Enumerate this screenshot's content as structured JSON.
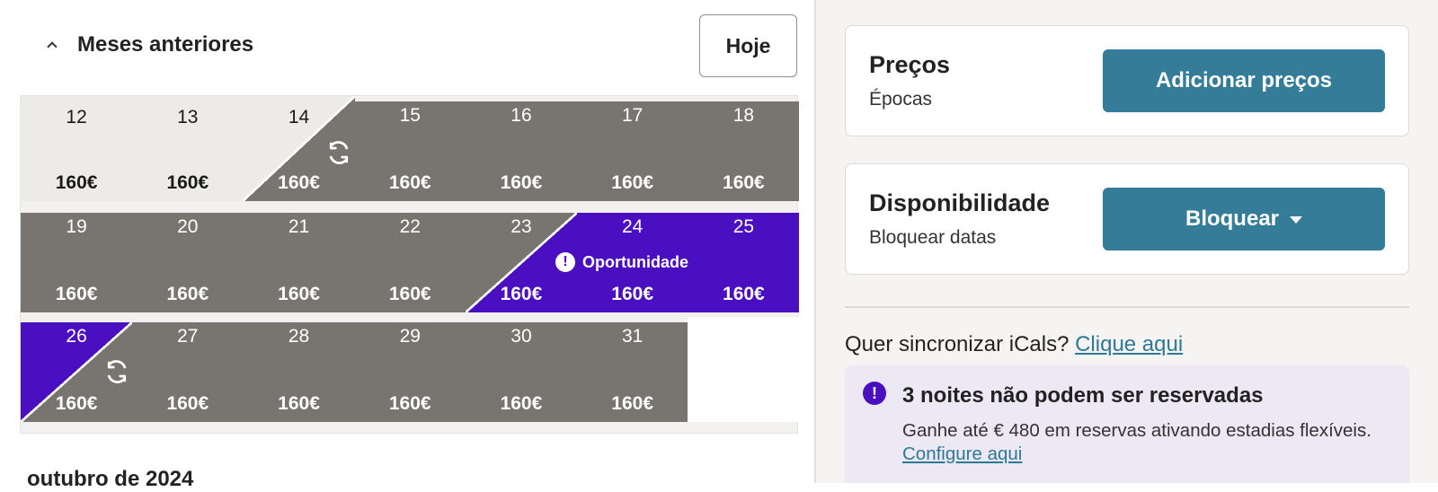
{
  "header": {
    "previous_months_label": "Meses anteriores",
    "today_button": "Hoje"
  },
  "calendar": {
    "weeks": [
      [
        {
          "day": "12",
          "price": "160€",
          "status": "past"
        },
        {
          "day": "13",
          "price": "160€",
          "status": "past"
        },
        {
          "day": "14",
          "price": "160€",
          "status": "past-to-blocked",
          "synced": true
        },
        {
          "day": "15",
          "price": "160€",
          "status": "blocked"
        },
        {
          "day": "16",
          "price": "160€",
          "status": "blocked"
        },
        {
          "day": "17",
          "price": "160€",
          "status": "blocked"
        },
        {
          "day": "18",
          "price": "160€",
          "status": "blocked"
        }
      ],
      [
        {
          "day": "19",
          "price": "160€",
          "status": "blocked"
        },
        {
          "day": "20",
          "price": "160€",
          "status": "blocked"
        },
        {
          "day": "21",
          "price": "160€",
          "status": "blocked"
        },
        {
          "day": "22",
          "price": "160€",
          "status": "blocked"
        },
        {
          "day": "23",
          "price": "160€",
          "status": "blocked-to-opportunity"
        },
        {
          "day": "24",
          "price": "160€",
          "status": "opportunity"
        },
        {
          "day": "25",
          "price": "160€",
          "status": "opportunity"
        }
      ],
      [
        {
          "day": "26",
          "price": "160€",
          "status": "opportunity-to-blocked",
          "synced": true
        },
        {
          "day": "27",
          "price": "160€",
          "status": "blocked"
        },
        {
          "day": "28",
          "price": "160€",
          "status": "blocked"
        },
        {
          "day": "29",
          "price": "160€",
          "status": "blocked"
        },
        {
          "day": "30",
          "price": "160€",
          "status": "blocked"
        },
        {
          "day": "31",
          "price": "160€",
          "status": "blocked"
        }
      ]
    ],
    "opportunity_label": "Oportunidade",
    "next_month_label": "outubro de 2024"
  },
  "prices_card": {
    "title": "Preços",
    "subtitle": "Épocas",
    "button": "Adicionar preços"
  },
  "availability_card": {
    "title": "Disponibilidade",
    "subtitle": "Bloquear datas",
    "button": "Bloquear"
  },
  "ical": {
    "question": "Quer sincronizar iCals?",
    "link": "Clique aqui"
  },
  "alert": {
    "title": "3 noites não podem ser reservadas",
    "body": "Ganhe até € 480 em reservas ativando estadias flexíveis.",
    "link": "Configure aqui"
  },
  "colors": {
    "past": "#ecebe8",
    "blocked": "#787570",
    "opportunity": "#4a0fc0",
    "button": "#347c98",
    "alert_bg": "#ece8f4",
    "link": "#2e7996"
  },
  "icons": {
    "collapse": "chevron-up-icon",
    "sync": "sync-icon",
    "alert": "exclamation-circle-icon",
    "dropdown": "caret-down-icon"
  }
}
